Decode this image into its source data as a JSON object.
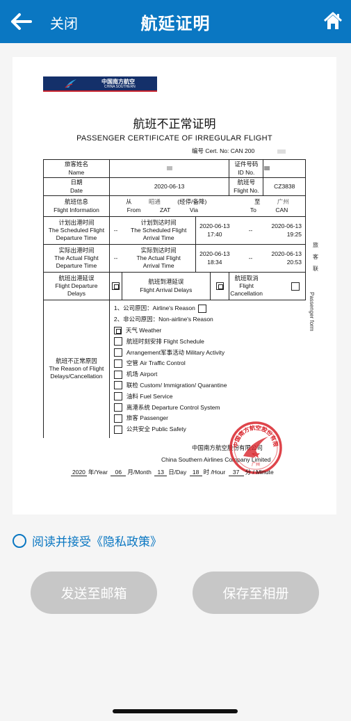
{
  "nav": {
    "close_label": "关闭",
    "title": "航延证明"
  },
  "certificate": {
    "logo_cn": "中国南方航空",
    "logo_en": "CHINA SOUTHERN",
    "title_cn": "航班不正常证明",
    "title_en": "PASSENGER CERTIFICATE OF IRREGULAR FLIGHT",
    "number_label": "编号 Cert. No:",
    "number_value": "CAN 200",
    "passenger_name_cn": "旅客姓名",
    "passenger_name_en": "Name",
    "id_no_cn": "证件号码",
    "id_no_en": "ID No.",
    "date_cn": "日期",
    "date_en": "Date",
    "date_value": "2020-06-13",
    "flight_no_cn": "航班号",
    "flight_no_en": "Flight No.",
    "flight_no_value": "CZ3838",
    "flight_info_cn": "航班信息",
    "flight_info_en": "Flight Information",
    "from_cn": "从",
    "from_city": "昭通",
    "via_cn": "(经停/备降)",
    "to_cn": "至",
    "to_city": "广州",
    "from_en": "From",
    "from_code": "ZAT",
    "via_en": "Via",
    "to_en": "To",
    "to_code": "CAN",
    "sched_dep_cn": "计划出港时间",
    "sched_dep_en1": "The Scheduled Flight",
    "sched_dep_en2": "Departure Time",
    "sched_arr_cn": "计划到达时间",
    "sched_arr_en1": "The Scheduled Flight",
    "sched_arr_en2": "Arrival Time",
    "sched_dep_date": "2020-06-13",
    "sched_dep_time": "17:40",
    "sched_arr_date": "2020-06-13",
    "sched_arr_time": "19:25",
    "actual_dep_cn": "实际出港时间",
    "actual_dep_en1": "The Actual Flight",
    "actual_dep_en2": "Departure Time",
    "actual_arr_cn": "实际到达时间",
    "actual_arr_en1": "The Actual Flight",
    "actual_arr_en2": "Arrival Time",
    "actual_dep_date": "2020-06-13",
    "actual_dep_time": "18:34",
    "actual_arr_date": "2020-06-13",
    "actual_arr_time": "20:53",
    "dash": "--",
    "dep_delay_cn": "航班出港延误",
    "dep_delay_en1": "Flight Departure",
    "dep_delay_en2": "Delays",
    "arr_delay_cn": "航班到港延误",
    "arr_delay_en": "Flight Arrival Delays",
    "cancel_cn": "航班取消",
    "cancel_en": "Flight Cancellation",
    "reason_cn": "航班不正常原因",
    "reason_en1": "The Reason of Flight",
    "reason_en2": "Delays/Cancellation",
    "reason_airline": "1、公司原因：Airline's Reason",
    "reason_non_airline": "2、非公司原因：Non-airline's Reason",
    "reasons": [
      "天气 Weather",
      "航班时刻安排 Flight Schedule",
      "Arrangement军事活动 Military Activity",
      "空管 Air Traffic Control",
      "机场 Airport",
      "联检 Custom/ Immigration/ Quarantine",
      "油料 Fuel Service",
      "离港系统 Departure Control System",
      "旅客 Passenger",
      "公共安全 Public Safety"
    ],
    "side_cn": [
      "旅",
      "客",
      "联"
    ],
    "side_en": "Passenger form",
    "company_cn": "中国南方航空股份有限公司",
    "company_en": "China Southern Airlines Company Limited",
    "stamp_text": "中国南方航空股份有限公司",
    "stamp_city": "广州",
    "year_value": "2020",
    "year_label": "年/Year",
    "month_value": "06",
    "month_label": "月/Month",
    "day_value": "13",
    "day_label": "日/Day",
    "hour_value": "18",
    "hour_label": "时 /Hour",
    "minute_value": "37",
    "minute_label": "分 / Minute"
  },
  "privacy": {
    "label": "阅读并接受《隐私政策》"
  },
  "actions": {
    "email_label": "发送至邮箱",
    "album_label": "保存至相册"
  },
  "colors": {
    "nav_bg": "#0a77c2",
    "button_disabled": "#c7c7c7",
    "stamp_red": "#d8232a"
  }
}
